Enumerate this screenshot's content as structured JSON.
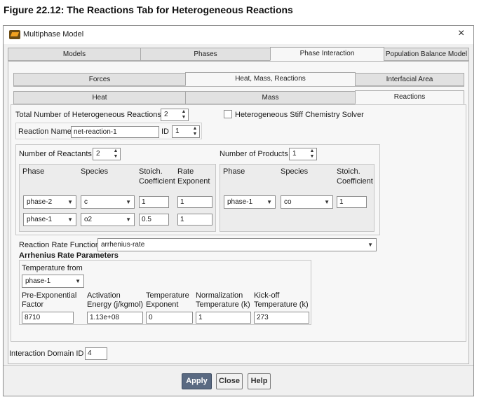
{
  "figure_caption": "Figure 22.12: The Reactions Tab for Heterogeneous Reactions",
  "window": {
    "title": "Multiphase Model",
    "close_symbol": "×"
  },
  "main_tabs": [
    "Models",
    "Phases",
    "Phase Interaction",
    "Population Balance Model"
  ],
  "sub_tabs": [
    "Forces",
    "Heat, Mass, Reactions",
    "Interfacial Area"
  ],
  "inner_tabs": [
    "Heat",
    "Mass",
    "Reactions"
  ],
  "reactions": {
    "total_label": "Total Number of Heterogeneous Reactions",
    "total_value": "2",
    "stiff_label": "Heterogeneous Stiff Chemistry Solver",
    "stiff_checked": false,
    "name_label": "Reaction Name",
    "name_value": "net-reaction-1",
    "id_label": "ID",
    "id_value": "1"
  },
  "reactants": {
    "count_label": "Number of Reactants",
    "count_value": "2",
    "headers": {
      "phase": "Phase",
      "species": "Species",
      "stoich_1": "Stoich.",
      "stoich_2": "Coefficient",
      "rate_1": "Rate",
      "rate_2": "Exponent"
    },
    "rows": [
      {
        "phase": "phase-2",
        "species": "c",
        "stoich": "1",
        "rate": "1"
      },
      {
        "phase": "phase-1",
        "species": "o2",
        "stoich": "0.5",
        "rate": "1"
      }
    ]
  },
  "products": {
    "count_label": "Number of Products",
    "count_value": "1",
    "headers": {
      "phase": "Phase",
      "species": "Species",
      "stoich_1": "Stoich.",
      "stoich_2": "Coefficient"
    },
    "rows": [
      {
        "phase": "phase-1",
        "species": "co",
        "stoich": "1"
      }
    ]
  },
  "rate_function": {
    "label": "Reaction Rate Function",
    "value": "arrhenius-rate"
  },
  "arrhenius": {
    "title": "Arrhenius Rate Parameters",
    "temp_from_label": "Temperature from",
    "temp_from_value": "phase-1",
    "columns": [
      {
        "l1": "Pre-Exponential",
        "l2": "Factor",
        "value": "8710"
      },
      {
        "l1": "Activation",
        "l2": "Energy (j/kgmol)",
        "value": "1.13e+08"
      },
      {
        "l1": "Temperature",
        "l2": "Exponent",
        "value": "0"
      },
      {
        "l1": "Normalization",
        "l2": "Temperature (k)",
        "value": "1"
      },
      {
        "l1": "Kick-off",
        "l2": "Temperature (k)",
        "value": "273"
      }
    ]
  },
  "interaction_domain": {
    "label": "Interaction Domain ID",
    "value": "4"
  },
  "buttons": {
    "apply": "Apply",
    "close": "Close",
    "help": "Help"
  },
  "icons": {
    "spin_up": "▲",
    "spin_down": "▼",
    "caret": "▼"
  }
}
